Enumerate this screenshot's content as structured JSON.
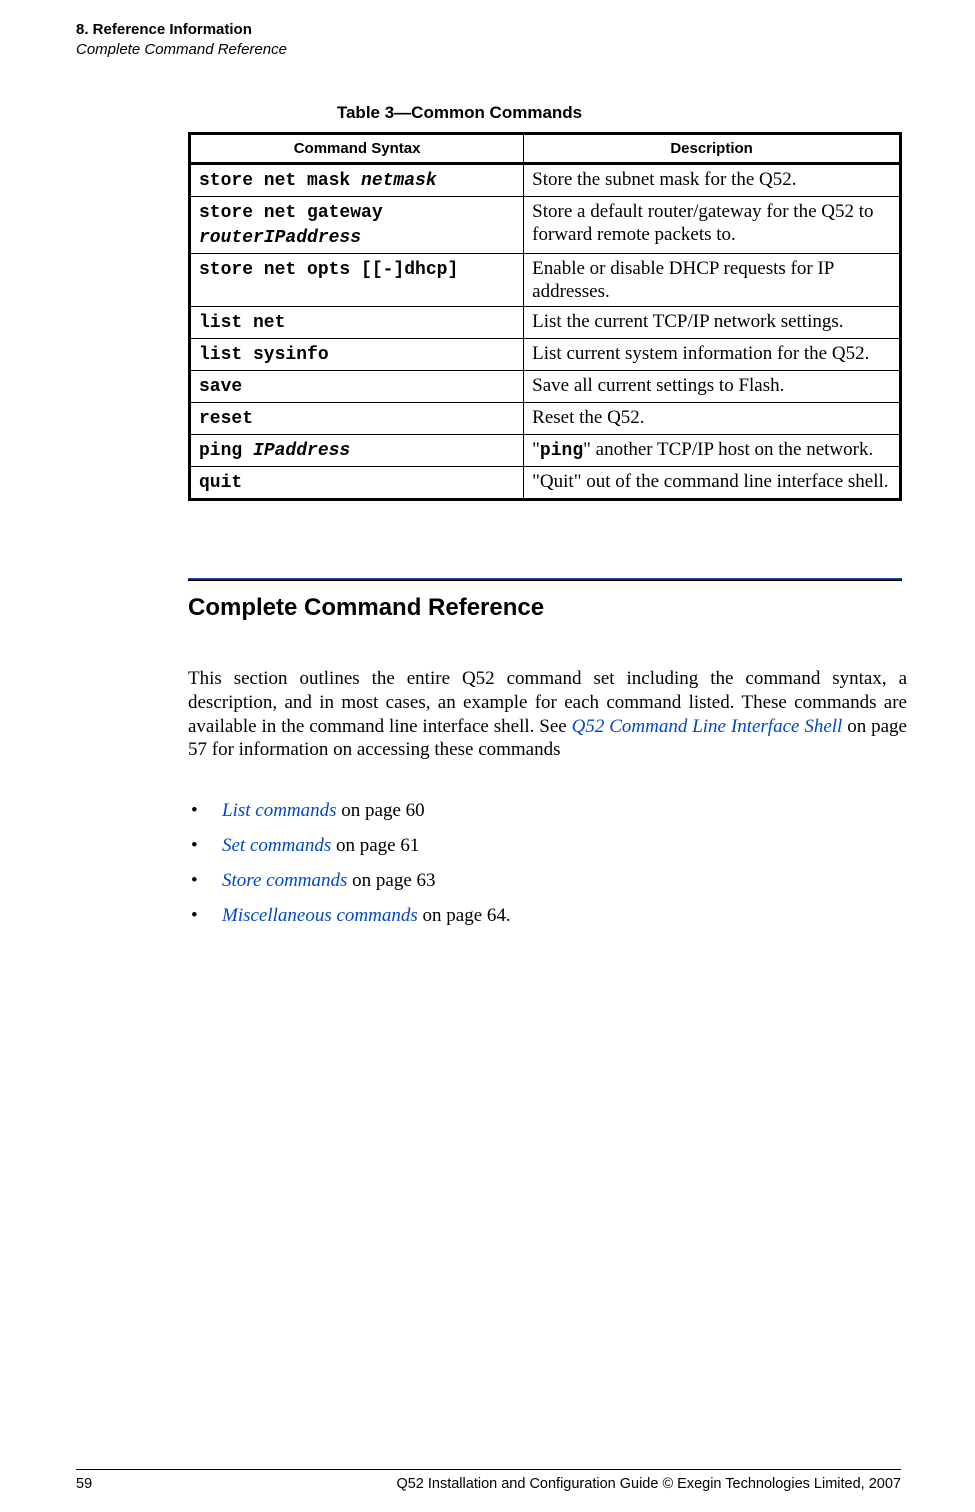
{
  "header": {
    "chapter": "8. Reference Information",
    "section": "Complete Command Reference"
  },
  "table": {
    "caption": "Table 3—Common Commands",
    "columns": [
      "Command Syntax",
      "Description"
    ],
    "rows": [
      {
        "cmd_prefix": "store net mask ",
        "cmd_arg": "netmask",
        "cmd_suffix": "",
        "desc": "Store the subnet mask for the Q52."
      },
      {
        "cmd_prefix": "store net gateway ",
        "cmd_arg": "routerIPaddress",
        "cmd_suffix": "",
        "desc": "Store a default router/gateway for the Q52 to forward remote packets to."
      },
      {
        "cmd_prefix": "store net opts [[-]dhcp]",
        "cmd_arg": "",
        "cmd_suffix": "",
        "desc": "Enable or disable DHCP requests for IP addresses."
      },
      {
        "cmd_prefix": "list net",
        "cmd_arg": "",
        "cmd_suffix": "",
        "desc": "List the current TCP/IP network settings."
      },
      {
        "cmd_prefix": "list sysinfo",
        "cmd_arg": "",
        "cmd_suffix": "",
        "desc": "List current system information for the Q52."
      },
      {
        "cmd_prefix": "save",
        "cmd_arg": "",
        "cmd_suffix": "",
        "desc": "Save all current settings to Flash."
      },
      {
        "cmd_prefix": "reset",
        "cmd_arg": "",
        "cmd_suffix": "",
        "desc": "Reset the Q52."
      },
      {
        "cmd_prefix": "ping ",
        "cmd_arg": "IPaddress",
        "cmd_suffix": "",
        "desc_pre": "\"",
        "desc_code": "ping",
        "desc_post": "\" another TCP/IP host on the network."
      },
      {
        "cmd_prefix": "quit",
        "cmd_arg": "",
        "cmd_suffix": "",
        "desc": "\"Quit\" out of the command line interface shell."
      }
    ]
  },
  "body": {
    "heading": "Complete Command Reference",
    "para_pre": "This section outlines the entire Q52 command set including the command syntax, a description, and in most cases, an example for each command listed. These commands are available in the command line interface shell. See ",
    "para_link": "Q52 Command Line Interface Shell",
    "para_post": " on page 57 for information on accessing these commands",
    "bullets": [
      {
        "link": "List commands",
        "rest": " on page 60"
      },
      {
        "link": "Set commands",
        "rest": " on page 61"
      },
      {
        "link": "Store commands",
        "rest": " on page 63"
      },
      {
        "link": "Miscellaneous commands",
        "rest": " on page 64."
      }
    ]
  },
  "footer": {
    "page": "59",
    "text": "Q52 Installation and Configuration Guide  © Exegin Technologies Limited, 2007"
  }
}
